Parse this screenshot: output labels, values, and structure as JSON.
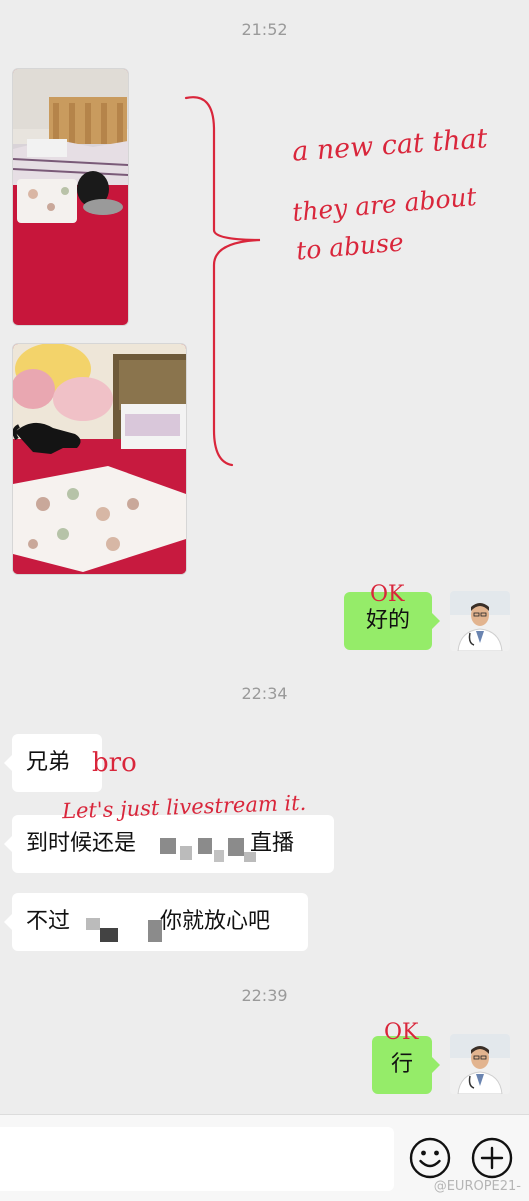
{
  "timestamps": [
    "21:52",
    "22:34",
    "22:39"
  ],
  "messages": {
    "reply_ok": "好的",
    "brother": "兄弟",
    "livestream_left": "到时候还是",
    "livestream_right": "直播",
    "dont_worry_left": "不过",
    "dont_worry_right": "你就放心吧",
    "reply_xing": "行"
  },
  "annotations": {
    "new_cat_1": "a new cat that",
    "new_cat_2": "they are about",
    "new_cat_3": "to abuse",
    "ok_1": "OK",
    "bro": "bro",
    "livestream": "Let's just livestream it.",
    "ok_2": "OK"
  },
  "watermark": "@EUROPE21-",
  "icons": {
    "emoji": "smiley-icon",
    "more": "plus-icon"
  },
  "colors": {
    "background": "#ededed",
    "outgoing_bubble": "#95ec69",
    "incoming_bubble": "#ffffff",
    "annotation": "#d9263b"
  }
}
